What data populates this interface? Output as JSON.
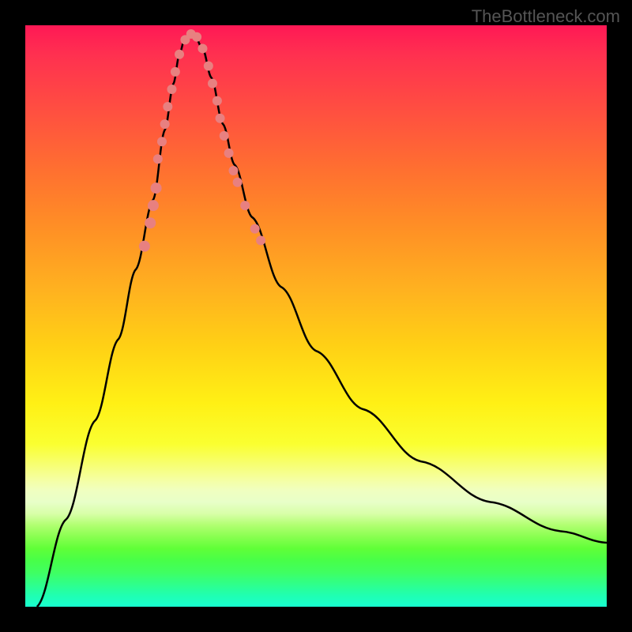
{
  "watermark": "TheBottleneck.com",
  "chart_data": {
    "type": "line",
    "title": "",
    "xlabel": "",
    "ylabel": "",
    "ylim": [
      0,
      100
    ],
    "xlim": [
      0,
      100
    ],
    "curve": {
      "description": "V-shaped bottleneck curve",
      "points": [
        {
          "x": 2,
          "y": 0
        },
        {
          "x": 7,
          "y": 15
        },
        {
          "x": 12,
          "y": 32
        },
        {
          "x": 16,
          "y": 46
        },
        {
          "x": 19,
          "y": 58
        },
        {
          "x": 22,
          "y": 70
        },
        {
          "x": 24,
          "y": 82
        },
        {
          "x": 25.5,
          "y": 90
        },
        {
          "x": 26.5,
          "y": 95
        },
        {
          "x": 27.5,
          "y": 98
        },
        {
          "x": 29,
          "y": 98.5
        },
        {
          "x": 30.5,
          "y": 96
        },
        {
          "x": 32,
          "y": 91
        },
        {
          "x": 34,
          "y": 83
        },
        {
          "x": 36,
          "y": 76
        },
        {
          "x": 39,
          "y": 67
        },
        {
          "x": 44,
          "y": 55
        },
        {
          "x": 50,
          "y": 44
        },
        {
          "x": 58,
          "y": 34
        },
        {
          "x": 68,
          "y": 25
        },
        {
          "x": 80,
          "y": 18
        },
        {
          "x": 92,
          "y": 13
        },
        {
          "x": 100,
          "y": 11
        }
      ]
    },
    "dots": [
      {
        "x": 20.5,
        "y": 62,
        "r": 7
      },
      {
        "x": 21.5,
        "y": 66,
        "r": 7
      },
      {
        "x": 22,
        "y": 69,
        "r": 7
      },
      {
        "x": 22.5,
        "y": 72,
        "r": 7
      },
      {
        "x": 22.8,
        "y": 77,
        "r": 6
      },
      {
        "x": 23.5,
        "y": 80,
        "r": 6
      },
      {
        "x": 24,
        "y": 83,
        "r": 6
      },
      {
        "x": 24.5,
        "y": 86,
        "r": 6
      },
      {
        "x": 25.2,
        "y": 89,
        "r": 6
      },
      {
        "x": 25.8,
        "y": 92,
        "r": 6
      },
      {
        "x": 26.5,
        "y": 95,
        "r": 6
      },
      {
        "x": 27.5,
        "y": 97.5,
        "r": 6
      },
      {
        "x": 28.5,
        "y": 98.5,
        "r": 6
      },
      {
        "x": 29.5,
        "y": 98,
        "r": 6
      },
      {
        "x": 30.5,
        "y": 96,
        "r": 6
      },
      {
        "x": 31.5,
        "y": 93,
        "r": 6
      },
      {
        "x": 32.2,
        "y": 90,
        "r": 6
      },
      {
        "x": 33,
        "y": 87,
        "r": 6
      },
      {
        "x": 33.5,
        "y": 84,
        "r": 6
      },
      {
        "x": 34.2,
        "y": 81,
        "r": 6
      },
      {
        "x": 35,
        "y": 78,
        "r": 6
      },
      {
        "x": 35.8,
        "y": 75,
        "r": 6
      },
      {
        "x": 36.5,
        "y": 73,
        "r": 6
      },
      {
        "x": 37.8,
        "y": 69,
        "r": 6
      },
      {
        "x": 39.5,
        "y": 65,
        "r": 6
      },
      {
        "x": 40.5,
        "y": 63,
        "r": 6
      }
    ]
  }
}
